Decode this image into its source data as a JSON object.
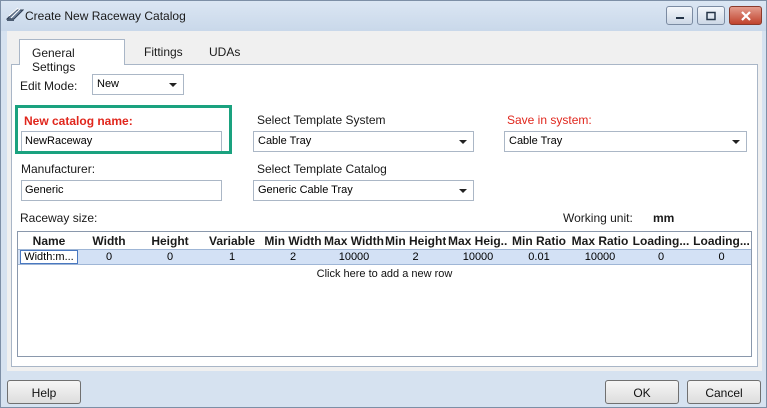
{
  "window": {
    "title": "Create New Raceway Catalog"
  },
  "tabs": [
    {
      "label": "General Settings",
      "active": true
    },
    {
      "label": "Fittings",
      "active": false
    },
    {
      "label": "UDAs",
      "active": false
    }
  ],
  "edit_mode": {
    "label": "Edit Mode:",
    "value": "New"
  },
  "new_catalog": {
    "label": "New catalog name:",
    "value": "NewRaceway"
  },
  "manufacturer": {
    "label": "Manufacturer:",
    "value": "Generic"
  },
  "template_system": {
    "label": "Select Template System",
    "value": "Cable Tray"
  },
  "template_catalog": {
    "label": "Select Template Catalog",
    "value": "Generic Cable Tray"
  },
  "save_in_system": {
    "label": "Save in system:",
    "value": "Cable Tray"
  },
  "raceway_size": {
    "label": "Raceway size:"
  },
  "working_unit": {
    "label": "Working unit:",
    "value": "mm"
  },
  "grid": {
    "columns": [
      "Name",
      "Width",
      "Height",
      "Variable",
      "Min Width",
      "Max Width",
      "Min Height",
      "Max Heig...",
      "Min Ratio",
      "Max Ratio",
      "Loading...",
      "Loading..."
    ],
    "rows": [
      [
        "Width:m...",
        "0",
        "0",
        "1",
        "2",
        "10000",
        "2",
        "10000",
        "0.01",
        "10000",
        "0",
        "0"
      ]
    ],
    "add_row_text": "Click here to add a new row"
  },
  "buttons": {
    "help": "Help",
    "ok": "OK",
    "cancel": "Cancel"
  },
  "colors": {
    "required_label": "#e0261c",
    "highlight_box": "#1aa27f",
    "selected_row": "#d3e1f5"
  },
  "icons": [
    "app-raceway-icon",
    "minimize-icon",
    "maximize-icon",
    "close-icon",
    "dropdown-arrow-icon"
  ]
}
